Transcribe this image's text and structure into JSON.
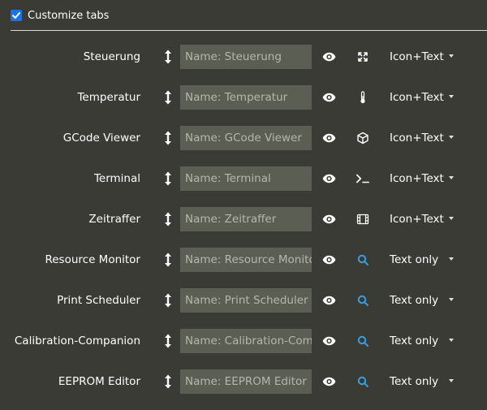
{
  "header": {
    "label": "Customize tabs",
    "checked": true
  },
  "colors": {
    "background": "#393b34",
    "input_background": "#5b5e52",
    "checkbox_accent": "#1a73e8",
    "search_icon": "#3a9de0"
  },
  "tabs": [
    {
      "label": "Steuerung",
      "placeholder": "Name: Steuerung",
      "icon": "fullscreen-icon",
      "mode": "Icon+Text"
    },
    {
      "label": "Temperatur",
      "placeholder": "Name: Temperatur",
      "icon": "thermometer-icon",
      "mode": "Icon+Text"
    },
    {
      "label": "GCode Viewer",
      "placeholder": "Name: GCode Viewer",
      "icon": "cube-icon",
      "mode": "Icon+Text"
    },
    {
      "label": "Terminal",
      "placeholder": "Name: Terminal",
      "icon": "terminal-icon",
      "mode": "Icon+Text"
    },
    {
      "label": "Zeitraffer",
      "placeholder": "Name: Zeitraffer",
      "icon": "film-icon",
      "mode": "Icon+Text"
    },
    {
      "label": "Resource Monitor",
      "placeholder": "Name: Resource Monitor",
      "icon": "search-icon",
      "mode": "Text only"
    },
    {
      "label": "Print Scheduler",
      "placeholder": "Name: Print Scheduler",
      "icon": "search-icon",
      "mode": "Text only"
    },
    {
      "label": "Calibration-Companion",
      "placeholder": "Name: Calibration-Companion",
      "icon": "search-icon",
      "mode": "Text only"
    },
    {
      "label": "EEPROM Editor",
      "placeholder": "Name: EEPROM Editor",
      "icon": "search-icon",
      "mode": "Text only"
    }
  ]
}
